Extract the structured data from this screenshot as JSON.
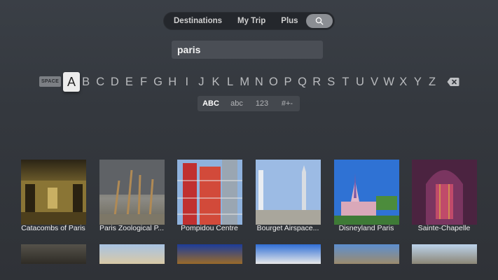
{
  "nav": {
    "tabs": [
      "Destinations",
      "My Trip",
      "Plus"
    ],
    "search_icon": "search-icon"
  },
  "search": {
    "value": "paris"
  },
  "keyboard": {
    "space_label": "SPACE",
    "letters": [
      "A",
      "B",
      "C",
      "D",
      "E",
      "F",
      "G",
      "H",
      "I",
      "J",
      "K",
      "L",
      "M",
      "N",
      "O",
      "P",
      "Q",
      "R",
      "S",
      "T",
      "U",
      "V",
      "W",
      "X",
      "Y",
      "Z"
    ],
    "selected": "A",
    "delete_icon": "backspace-icon",
    "modes": [
      "ABC",
      "abc",
      "123",
      "#+-"
    ],
    "active_mode": "ABC"
  },
  "results": [
    {
      "caption": "Catacombs of Paris"
    },
    {
      "caption": "Paris Zoological P..."
    },
    {
      "caption": "Pompidou Centre"
    },
    {
      "caption": "Bourget Airspace..."
    },
    {
      "caption": "Disneyland Paris"
    },
    {
      "caption": "Sainte-Chapelle"
    }
  ]
}
